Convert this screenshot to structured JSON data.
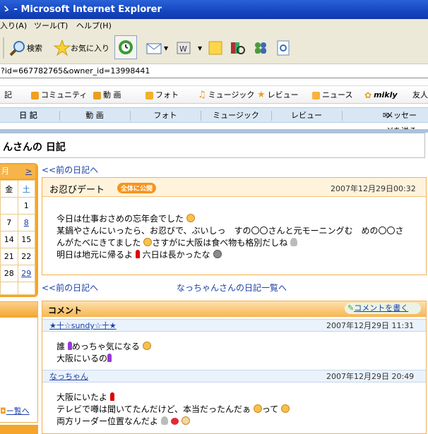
{
  "window": {
    "title": "Microsoft Internet Explorer",
    "title_prefix": "ゝ -"
  },
  "menu": {
    "items": [
      "入り(A)",
      "ツール(T)",
      "ヘルプ(H)"
    ]
  },
  "toolbar": {
    "search_label": "検索",
    "favorites_label": "お気に入り"
  },
  "address": {
    "url_fragment": "?id=667782765&owner_id=13998441"
  },
  "sitenav": {
    "items": [
      "記",
      "コミュニティ",
      "動 画",
      "フォト",
      "ミュージック",
      "レビュー",
      "ニュース",
      "mikly",
      "友人"
    ]
  },
  "subnav": {
    "items": [
      "日 記",
      "動 画",
      "フォト",
      "ミュージック",
      "レビュー",
      "メッセージを送る"
    ]
  },
  "page": {
    "title": "んさんの 日記"
  },
  "calendar": {
    "header": "月",
    "next": ">",
    "dow": [
      "金",
      "土"
    ],
    "rows": [
      [
        "",
        "1"
      ],
      [
        "7",
        "8"
      ],
      [
        "14",
        "15"
      ],
      [
        "21",
        "22"
      ],
      [
        "28",
        "29"
      ]
    ],
    "linked": [
      "8",
      "29"
    ]
  },
  "sidebar": {
    "link": "ー覧へ"
  },
  "nav": {
    "prev_top": "<<前の日記へ",
    "prev_bottom": "<<前の日記へ",
    "list_link": "なっちゃんさんの日記一覧へ"
  },
  "entry": {
    "title": "お忍びデート",
    "badge": "全体に公開",
    "date": "2007年12月29日00:32",
    "lines": [
      "今日は仕事おさめの忘年会でした",
      "某鍋やさんにいったら、お忍びで、ぶいしっ　すの〇〇さんと元モーニングむ　めの〇〇さ",
      "んがたべにきてました",
      "さすがに大阪は食べ物も格別だしね",
      "明日は地元に帰るよ",
      "六日は長かったな"
    ]
  },
  "comments": {
    "header": "コメント",
    "write": "コメントを書く",
    "items": [
      {
        "author": "★十☆sundy☆十★",
        "date": "2007年12月29日 11:31",
        "lines": [
          "誰",
          "めっちゃ気になる",
          "大阪にいるの"
        ]
      },
      {
        "author": "なっちゃん",
        "date": "2007年12月29日 20:49",
        "lines": [
          "大阪にいたよ",
          "テレビで噂は聞いてたんだけど、本当だったんだぁ",
          "って",
          "両方リーダー位置なんだよ"
        ]
      }
    ]
  },
  "colors": {
    "accent_orange": "#f7941d",
    "link_blue": "#1a3fa8",
    "titlebar_blue": "#1545c0"
  }
}
